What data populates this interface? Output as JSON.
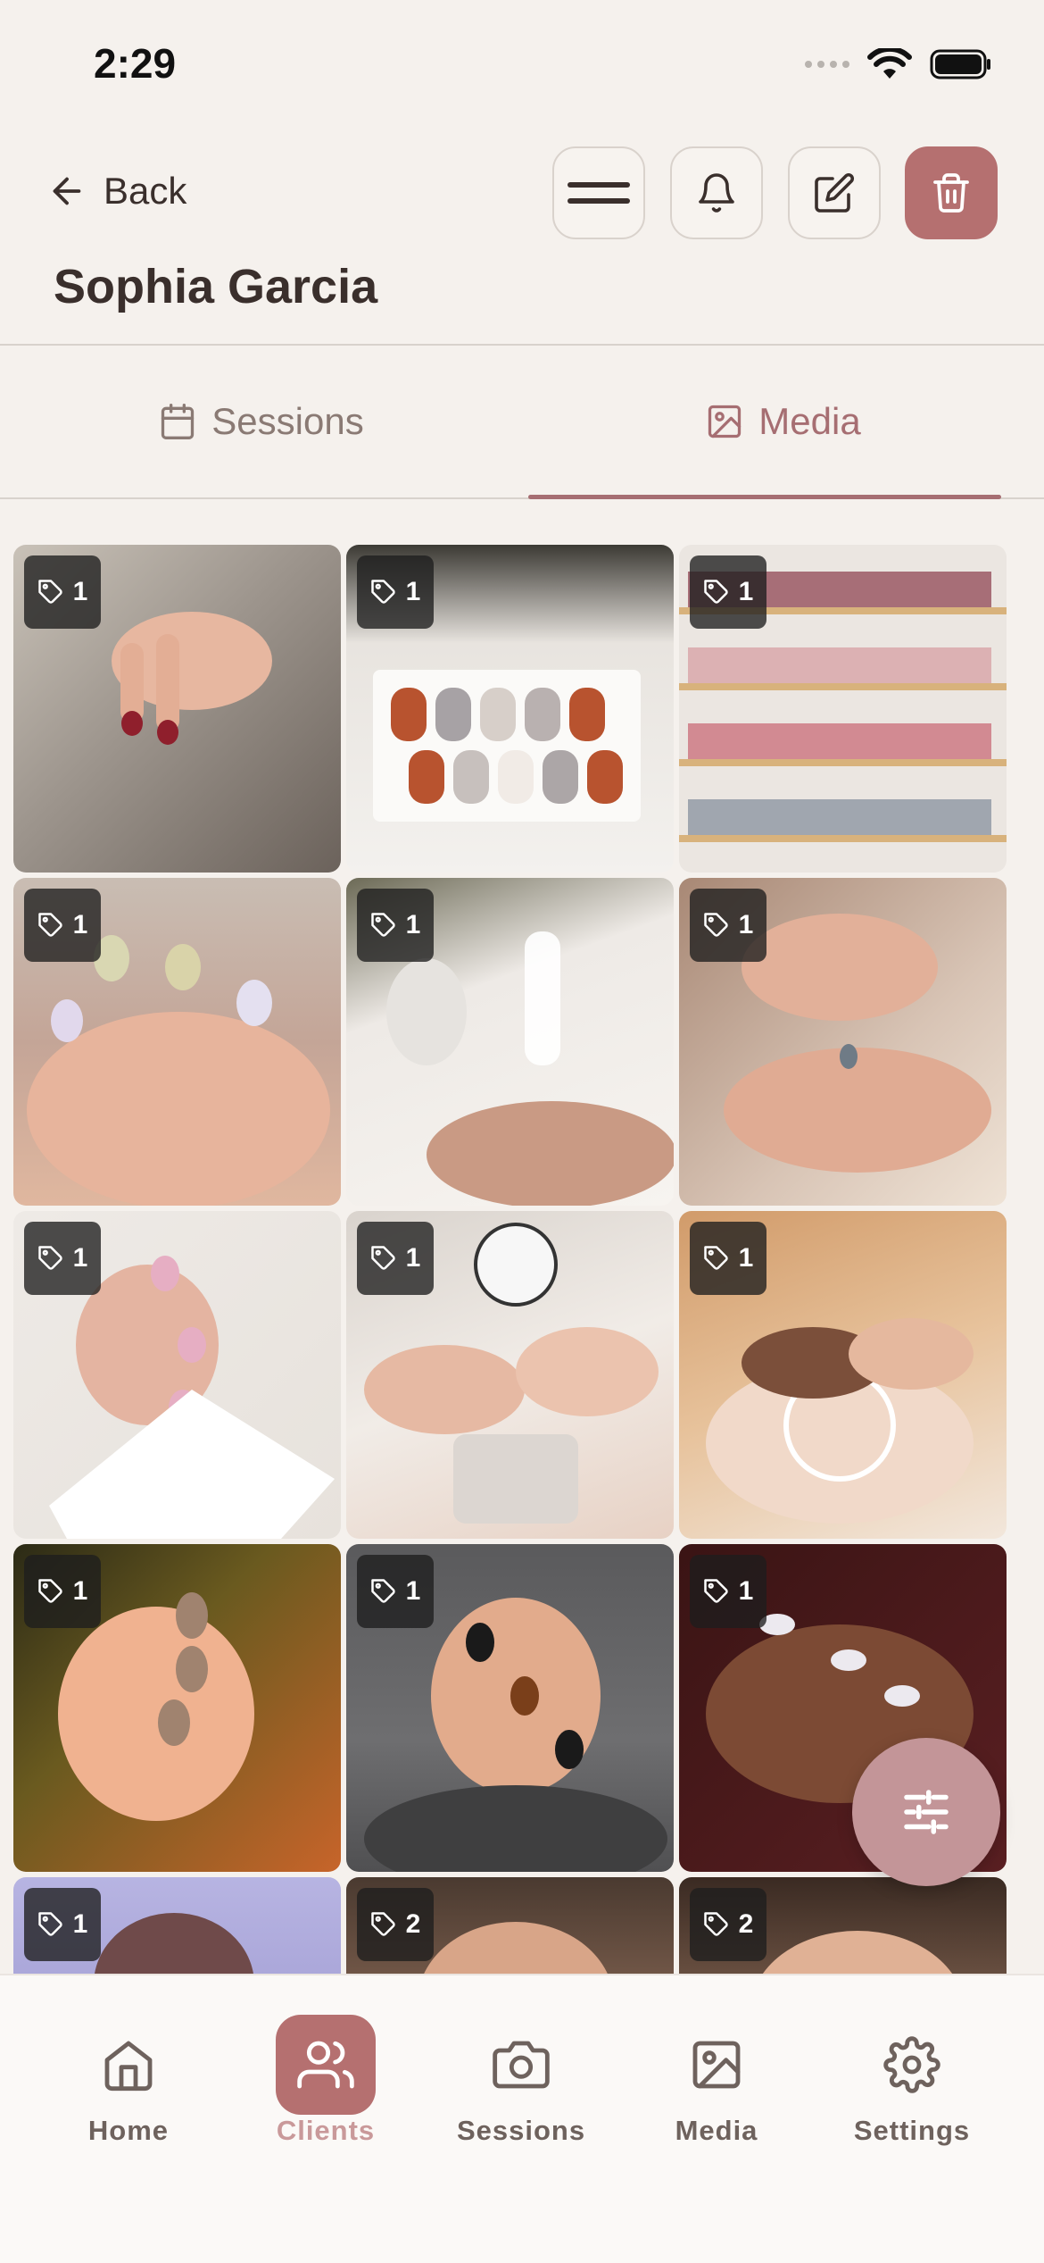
{
  "status_bar": {
    "time": "2:29"
  },
  "header": {
    "back_label": "Back",
    "client_name": "Sophia Garcia"
  },
  "tabs": [
    {
      "label": "Sessions",
      "active": false
    },
    {
      "label": "Media",
      "active": true
    }
  ],
  "media": [
    {
      "tag_count": "1"
    },
    {
      "tag_count": "1"
    },
    {
      "tag_count": "1"
    },
    {
      "tag_count": "1"
    },
    {
      "tag_count": "1"
    },
    {
      "tag_count": "1"
    },
    {
      "tag_count": "1"
    },
    {
      "tag_count": "1"
    },
    {
      "tag_count": "1"
    },
    {
      "tag_count": "1"
    },
    {
      "tag_count": "1"
    },
    {
      "tag_count": "1"
    },
    {
      "tag_count": "1"
    },
    {
      "tag_count": "2"
    },
    {
      "tag_count": "2"
    }
  ],
  "bottom_nav": [
    {
      "label": "Home",
      "icon": "home-icon",
      "active": false
    },
    {
      "label": "Clients",
      "icon": "users-icon",
      "active": true
    },
    {
      "label": "Sessions",
      "icon": "camera-icon",
      "active": false
    },
    {
      "label": "Media",
      "icon": "image-icon",
      "active": false
    },
    {
      "label": "Settings",
      "icon": "gear-icon",
      "active": false
    }
  ],
  "colors": {
    "accent": "#b57070",
    "tab_active": "#a66e72",
    "background": "#f5f1ed"
  }
}
